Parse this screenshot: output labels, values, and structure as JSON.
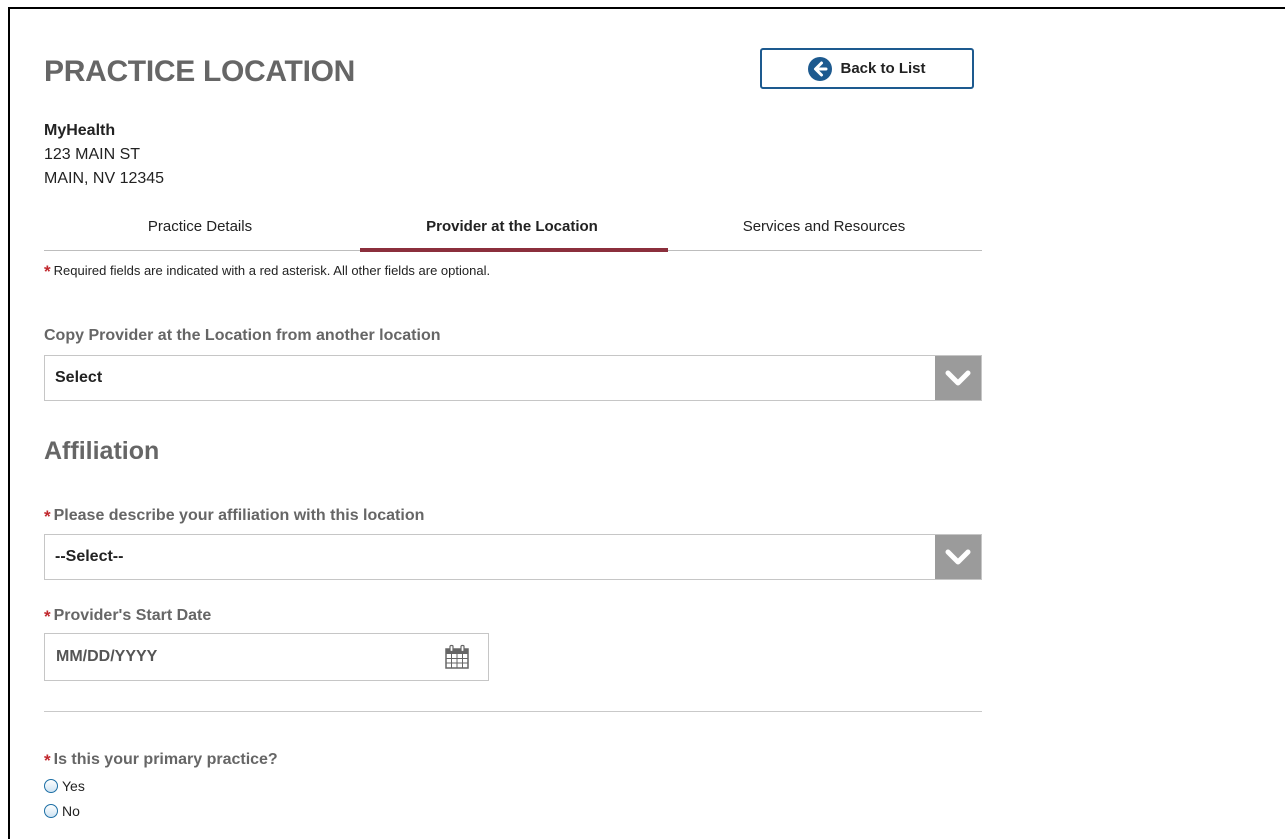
{
  "page": {
    "title": "PRACTICE LOCATION",
    "back_button_label": "Back to List"
  },
  "organization": {
    "name": "MyHealth",
    "address_line1": "123 MAIN ST",
    "address_line2": "MAIN, NV 12345"
  },
  "tabs": [
    {
      "label": "Practice Details",
      "active": false
    },
    {
      "label": "Provider at the Location",
      "active": true
    },
    {
      "label": "Services and Resources",
      "active": false
    }
  ],
  "required_note": {
    "asterisk": "*",
    "text": "Required fields are indicated with a red asterisk. All other fields are optional."
  },
  "copy_provider": {
    "label": "Copy Provider at the Location from another location",
    "selected": "Select"
  },
  "affiliation": {
    "section_title": "Affiliation",
    "describe_label": "Please describe your affiliation with this location",
    "describe_selected": "--Select--",
    "start_date_label": "Provider's Start Date",
    "start_date_placeholder": "MM/DD/YYYY",
    "start_date_value": ""
  },
  "primary_practice": {
    "question": "Is this your primary practice?",
    "options": [
      "Yes",
      "No"
    ]
  },
  "colors": {
    "accent": "#1d5a8f",
    "active_tab": "#8b2f3c",
    "asterisk": "#c1272d",
    "chevron_bg": "#9b9b9b"
  }
}
